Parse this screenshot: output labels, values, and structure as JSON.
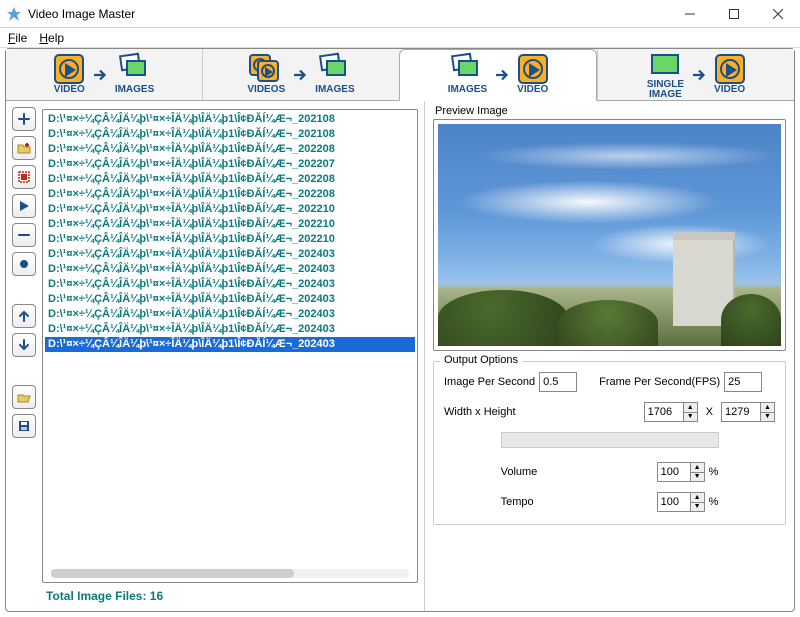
{
  "window": {
    "title": "Video Image Master",
    "app_icon": "wizard-icon"
  },
  "menu": {
    "file": "File",
    "help": "Help"
  },
  "tabs": [
    {
      "from": "VIDEO",
      "to": "IMAGES",
      "from_icon": "video",
      "to_icon": "images",
      "active": false
    },
    {
      "from": "VIDEOS",
      "to": "IMAGES",
      "from_icon": "videos",
      "to_icon": "images",
      "active": false
    },
    {
      "from": "IMAGES",
      "to": "VIDEO",
      "from_icon": "images",
      "to_icon": "video",
      "active": true
    },
    {
      "from": "SINGLE\nIMAGE",
      "to": "VIDEO",
      "from_icon": "single",
      "to_icon": "video",
      "active": false
    }
  ],
  "toolbar": [
    {
      "name": "add",
      "glyph": "plus",
      "color": "blue"
    },
    {
      "name": "add-folder",
      "glyph": "folder-plus",
      "color": "red"
    },
    {
      "name": "select-all",
      "glyph": "select-all",
      "color": "red"
    },
    {
      "name": "play",
      "glyph": "play",
      "color": "blue"
    },
    {
      "name": "remove",
      "glyph": "minus",
      "color": "blue"
    },
    {
      "name": "clear",
      "glyph": "clear",
      "color": "blue"
    },
    {
      "gap": true
    },
    {
      "name": "move-up",
      "glyph": "arrow-up",
      "color": "blue"
    },
    {
      "name": "move-down",
      "glyph": "arrow-down",
      "color": "blue"
    },
    {
      "gap": true
    },
    {
      "name": "open",
      "glyph": "folder-open",
      "color": "red"
    },
    {
      "name": "save",
      "glyph": "floppy",
      "color": "blue"
    }
  ],
  "files": {
    "items": [
      "D:\\¹¤×÷¼ÇÂ¼ÎÄ¼þ\\¹¤×÷ÎÄ¼þ\\ÎÄ¼þ1\\Î¢ĐĂÍ¼Æ¬_202108",
      "D:\\¹¤×÷¼ÇÂ¼ÎÄ¼þ\\¹¤×÷ÎÄ¼þ\\ÎÄ¼þ1\\Î¢ĐĂÍ¼Æ¬_202108",
      "D:\\¹¤×÷¼ÇÂ¼ÎÄ¼þ\\¹¤×÷ÎÄ¼þ\\ÎÄ¼þ1\\Î¢ĐĂÍ¼Æ¬_202208",
      "D:\\¹¤×÷¼ÇÂ¼ÎÄ¼þ\\¹¤×÷ÎÄ¼þ\\ÎÄ¼þ1\\Î¢ĐĂÍ¼Æ¬_202207",
      "D:\\¹¤×÷¼ÇÂ¼ÎÄ¼þ\\¹¤×÷ÎÄ¼þ\\ÎÄ¼þ1\\Î¢ĐĂÍ¼Æ¬_202208",
      "D:\\¹¤×÷¼ÇÂ¼ÎÄ¼þ\\¹¤×÷ÎÄ¼þ\\ÎÄ¼þ1\\Î¢ĐĂÍ¼Æ¬_202208",
      "D:\\¹¤×÷¼ÇÂ¼ÎÄ¼þ\\¹¤×÷ÎÄ¼þ\\ÎÄ¼þ1\\Î¢ĐĂÍ¼Æ¬_202210",
      "D:\\¹¤×÷¼ÇÂ¼ÎÄ¼þ\\¹¤×÷ÎÄ¼þ\\ÎÄ¼þ1\\Î¢ĐĂÍ¼Æ¬_202210",
      "D:\\¹¤×÷¼ÇÂ¼ÎÄ¼þ\\¹¤×÷ÎÄ¼þ\\ÎÄ¼þ1\\Î¢ĐĂÍ¼Æ¬_202210",
      "D:\\¹¤×÷¼ÇÂ¼ÎÄ¼þ\\¹¤×÷ÎÄ¼þ\\ÎÄ¼þ1\\Î¢ĐĂÍ¼Æ¬_202403",
      "D:\\¹¤×÷¼ÇÂ¼ÎÄ¼þ\\¹¤×÷ÎÄ¼þ\\ÎÄ¼þ1\\Î¢ĐĂÍ¼Æ¬_202403",
      "D:\\¹¤×÷¼ÇÂ¼ÎÄ¼þ\\¹¤×÷ÎÄ¼þ\\ÎÄ¼þ1\\Î¢ĐĂÍ¼Æ¬_202403",
      "D:\\¹¤×÷¼ÇÂ¼ÎÄ¼þ\\¹¤×÷ÎÄ¼þ\\ÎÄ¼þ1\\Î¢ĐĂÍ¼Æ¬_202403",
      "D:\\¹¤×÷¼ÇÂ¼ÎÄ¼þ\\¹¤×÷ÎÄ¼þ\\ÎÄ¼þ1\\Î¢ĐĂÍ¼Æ¬_202403",
      "D:\\¹¤×÷¼ÇÂ¼ÎÄ¼þ\\¹¤×÷ÎÄ¼þ\\ÎÄ¼þ1\\Î¢ĐĂÍ¼Æ¬_202403",
      "D:\\¹¤×÷¼ÇÂ¼ÎÄ¼þ\\¹¤×÷ÎÄ¼þ\\ÎÄ¼þ1\\Î¢ĐĂÍ¼Æ¬_202403"
    ],
    "selected_index": 15,
    "total_label": "Total Image Files: 16"
  },
  "preview": {
    "title": "Preview Image"
  },
  "output": {
    "legend": "Output Options",
    "ips_label": "Image Per Second",
    "ips_value": "0.5",
    "fps_label": "Frame Per Second(FPS)",
    "fps_value": "25",
    "dim_label": "Width x Height",
    "width": "1706",
    "x": "X",
    "height": "1279",
    "volume_label": "Volume",
    "volume_value": "100",
    "volume_unit": "%",
    "tempo_label": "Tempo",
    "tempo_value": "100",
    "tempo_unit": "%"
  }
}
